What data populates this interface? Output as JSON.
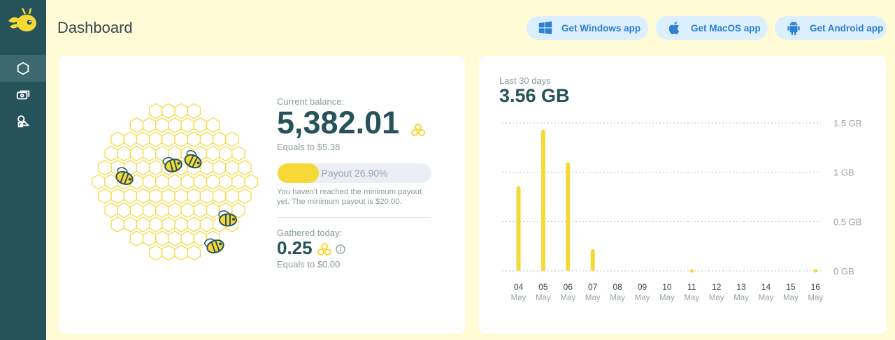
{
  "header": {
    "title": "Dashboard"
  },
  "apps": [
    {
      "label": "Get Windows app",
      "icon": "windows-icon"
    },
    {
      "label": "Get MacOS app",
      "icon": "apple-icon"
    },
    {
      "label": "Get Android app",
      "icon": "android-icon"
    }
  ],
  "sidebar": {
    "items": [
      {
        "icon": "hexagon-icon",
        "active": true
      },
      {
        "icon": "money-icon",
        "active": false
      },
      {
        "icon": "shapes-icon",
        "active": false
      }
    ]
  },
  "balance": {
    "label": "Current balance:",
    "value": "5,382.01",
    "equals": "Equals to $5.38",
    "payout_text": "Payout 26.90%",
    "payout_fraction": 0.269,
    "note": "You haven't reached the minimum payout yet. The minimum payout is $20.00."
  },
  "today": {
    "label": "Gathered today:",
    "value": "0.25",
    "equals": "Equals to $0.00"
  },
  "traffic": {
    "label": "Last 30 days",
    "total": "3.56 GB"
  },
  "colors": {
    "accent": "#f6d837",
    "dark": "#26525a",
    "sidebar": "#26525a",
    "button_text": "#2f80d0"
  },
  "chart_data": {
    "type": "bar",
    "categories": [
      [
        "04",
        "May"
      ],
      [
        "05",
        "May"
      ],
      [
        "06",
        "May"
      ],
      [
        "07",
        "May"
      ],
      [
        "08",
        "May"
      ],
      [
        "09",
        "May"
      ],
      [
        "10",
        "May"
      ],
      [
        "11",
        "May"
      ],
      [
        "12",
        "May"
      ],
      [
        "13",
        "May"
      ],
      [
        "14",
        "May"
      ],
      [
        "15",
        "May"
      ],
      [
        "16",
        "May"
      ]
    ],
    "values": [
      0.86,
      1.43,
      1.1,
      0.22,
      0,
      0,
      0,
      0.01,
      0,
      0,
      0,
      0,
      0.01
    ],
    "yticks": [
      "1.5 GB",
      "1 GB",
      "0.5 GB",
      "0 GB"
    ],
    "ylim": [
      0,
      1.5
    ],
    "grid": true
  }
}
